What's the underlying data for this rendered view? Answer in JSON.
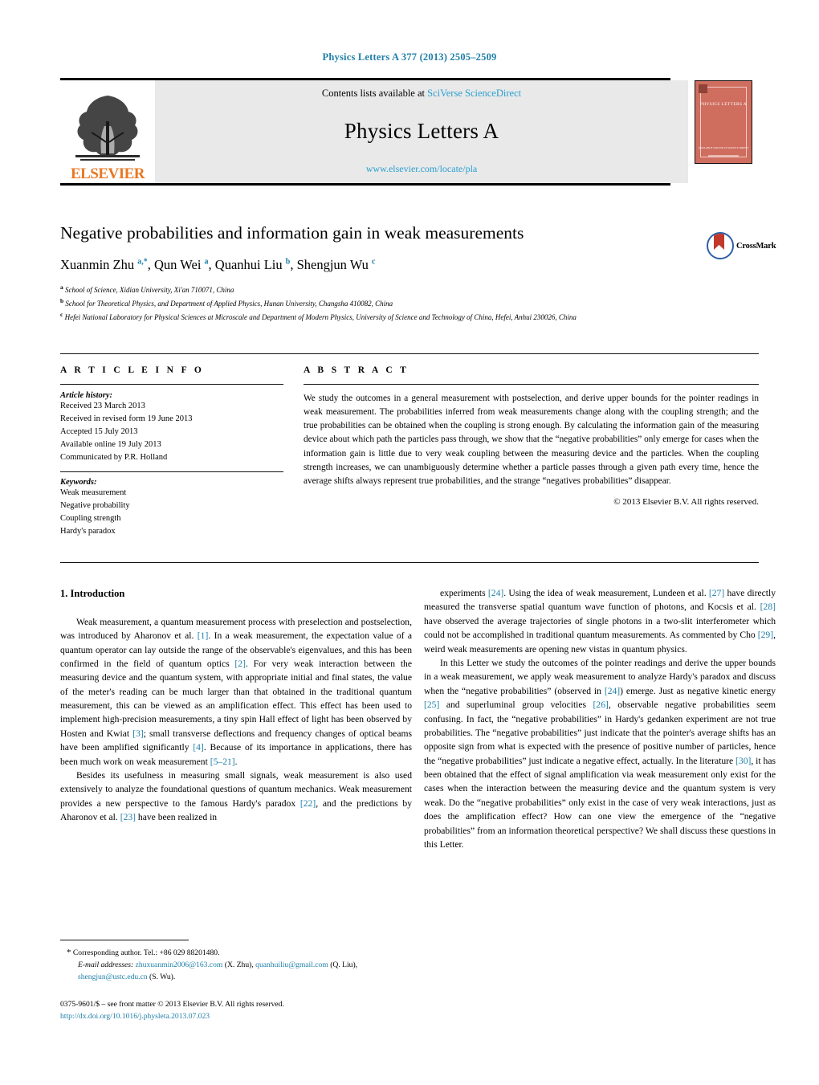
{
  "running_head": "Physics Letters A 377 (2013) 2505–2509",
  "masthead": {
    "publisher": "ELSEVIER",
    "contents_prefix": "Contents lists available at ",
    "contents_link": "SciVerse ScienceDirect",
    "journal_title": "Physics Letters A",
    "journal_url": "www.elsevier.com/locate/pla",
    "cover_title": "PHYSICS LETTERS A",
    "cover_footer": "AVAILABLE ONLINE AT\nSCIENCE DIRECT"
  },
  "article": {
    "title": "Negative probabilities and information gain in weak measurements",
    "authors": [
      {
        "name": "Xuanmin Zhu",
        "marks": "a,*"
      },
      {
        "name": "Qun Wei",
        "marks": "a"
      },
      {
        "name": "Quanhui Liu",
        "marks": "b"
      },
      {
        "name": "Shengjun Wu",
        "marks": "c"
      }
    ],
    "affiliations": [
      {
        "mark": "a",
        "text": "School of Science, Xidian University, Xi'an 710071, China"
      },
      {
        "mark": "b",
        "text": "School for Theoretical Physics, and Department of Applied Physics, Hunan University, Changsha 410082, China"
      },
      {
        "mark": "c",
        "text": "Hefei National Laboratory for Physical Sciences at Microscale and Department of Modern Physics, University of Science and Technology of China, Hefei, Anhui 230026, China"
      }
    ],
    "crossmark_label": "CrossMark"
  },
  "info": {
    "heading": "A R T I C L E   I N F O",
    "history_label": "Article history:",
    "history": [
      "Received 23 March 2013",
      "Received in revised form 19 June 2013",
      "Accepted 15 July 2013",
      "Available online 19 July 2013",
      "Communicated by P.R. Holland"
    ],
    "keywords_label": "Keywords:",
    "keywords": [
      "Weak measurement",
      "Negative probability",
      "Coupling strength",
      "Hardy's paradox"
    ]
  },
  "abstract": {
    "heading": "A B S T R A C T",
    "text": "We study the outcomes in a general measurement with postselection, and derive upper bounds for the pointer readings in weak measurement. The probabilities inferred from weak measurements change along with the coupling strength; and the true probabilities can be obtained when the coupling is strong enough. By calculating the information gain of the measuring device about which path the particles pass through, we show that the “negative probabilities” only emerge for cases when the information gain is little due to very weak coupling between the measuring device and the particles. When the coupling strength increases, we can unambiguously determine whether a particle passes through a given path every time, hence the average shifts always represent true probabilities, and the strange “negatives probabilities” disappear.",
    "copyright": "© 2013 Elsevier B.V. All rights reserved."
  },
  "body": {
    "section_title": "1. Introduction",
    "left_paragraphs": [
      "Weak measurement, a quantum measurement process with preselection and postselection, was introduced by Aharonov et al. [1]. In a weak measurement, the expectation value of a quantum operator can lay outside the range of the observable's eigenvalues, and this has been confirmed in the field of quantum optics [2]. For very weak interaction between the measuring device and the quantum system, with appropriate initial and final states, the value of the meter's reading can be much larger than that obtained in the traditional quantum measurement, this can be viewed as an amplification effect. This effect has been used to implement high-precision measurements, a tiny spin Hall effect of light has been observed by Hosten and Kwiat [3]; small transverse deflections and frequency changes of optical beams have been amplified significantly [4]. Because of its importance in applications, there has been much work on weak measurement [5–21].",
      "Besides its usefulness in measuring small signals, weak measurement is also used extensively to analyze the foundational questions of quantum mechanics. Weak measurement provides a new perspective to the famous Hardy's paradox [22], and the predictions by Aharonov et al. [23] have been realized in"
    ],
    "right_paragraphs": [
      "experiments [24]. Using the idea of weak measurement, Lundeen et al. [27] have directly measured the transverse spatial quantum wave function of photons, and Kocsis et al. [28] have observed the average trajectories of single photons in a two-slit interferometer which could not be accomplished in traditional quantum measurements. As commented by Cho [29], weird weak measurements are opening new vistas in quantum physics.",
      "In this Letter we study the outcomes of the pointer readings and derive the upper bounds in a weak measurement, we apply weak measurement to analyze Hardy's paradox and discuss when the “negative probabilities” (observed in [24]) emerge. Just as negative kinetic energy [25] and superluminal group velocities [26], observable negative probabilities seem confusing. In fact, the “negative probabilities” in Hardy's gedanken experiment are not true probabilities. The “negative probabilities” just indicate that the pointer's average shifts has an opposite sign from what is expected with the presence of positive number of particles, hence the “negative probabilities” just indicate a negative effect, actually. In the literature [30], it has been obtained that the effect of signal amplification via weak measurement only exist for the cases when the interaction between the measuring device and the quantum system is very weak. Do the “negative probabilities” only exist in the case of very weak interactions, just as does the amplification effect? How can one view the emergence of the “negative probabilities” from an information theoretical perspective? We shall discuss these questions in this Letter."
    ]
  },
  "footnote": {
    "star": "*",
    "corresponding": "Corresponding author. Tel.: +86 029 88201480.",
    "email_label": "E-mail addresses:",
    "emails": [
      {
        "address": "zhuxuanmin2006@163.com",
        "owner": "(X. Zhu)"
      },
      {
        "address": "quanhuiliu@gmail.com",
        "owner": "(Q. Liu)"
      },
      {
        "address": "shengjun@ustc.edu.cn",
        "owner": "(S. Wu)"
      }
    ]
  },
  "colophon": {
    "line1": "0375-9601/$ – see front matter © 2013 Elsevier B.V. All rights reserved.",
    "doi": "http://dx.doi.org/10.1016/j.physleta.2013.07.023"
  }
}
